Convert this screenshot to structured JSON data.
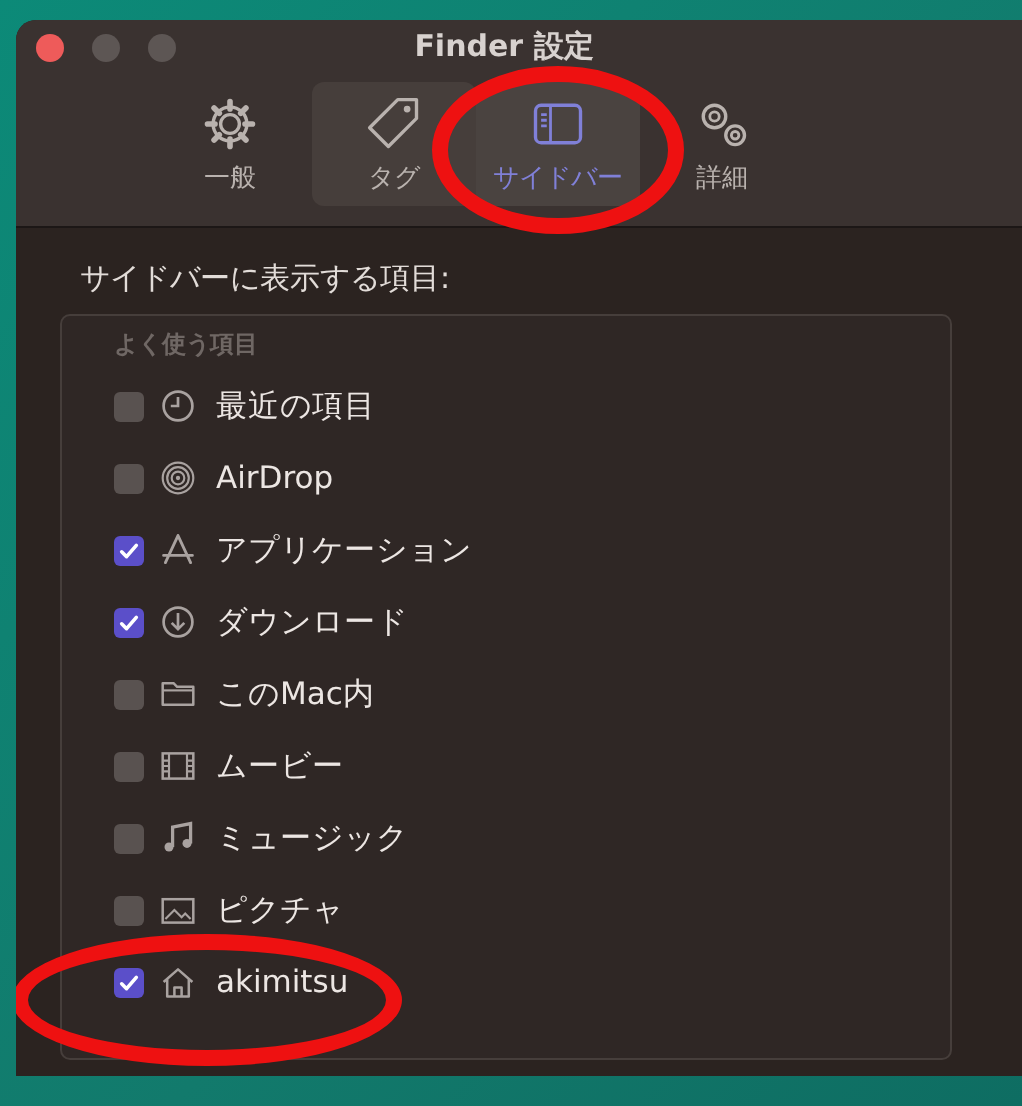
{
  "window": {
    "title": "Finder 設定"
  },
  "tabs": [
    {
      "label": "一般",
      "selected": false,
      "hovered": false,
      "circled": false
    },
    {
      "label": "タグ",
      "selected": false,
      "hovered": true,
      "circled": false
    },
    {
      "label": "サイドバー",
      "selected": true,
      "hovered": false,
      "circled": true
    },
    {
      "label": "詳細",
      "selected": false,
      "hovered": false,
      "circled": false
    }
  ],
  "section_label": "サイドバーに表示する項目:",
  "group_header": "よく使う項目",
  "items": [
    {
      "label": "最近の項目",
      "checked": false,
      "circled": false
    },
    {
      "label": "AirDrop",
      "checked": false,
      "circled": false
    },
    {
      "label": "アプリケーション",
      "checked": true,
      "circled": false
    },
    {
      "label": "ダウンロード",
      "checked": true,
      "circled": false
    },
    {
      "label": "このMac内",
      "checked": false,
      "circled": false
    },
    {
      "label": "ムービー",
      "checked": false,
      "circled": false
    },
    {
      "label": "ミュージック",
      "checked": false,
      "circled": false
    },
    {
      "label": "ピクチャ",
      "checked": false,
      "circled": false
    },
    {
      "label": "akimitsu",
      "checked": true,
      "circled": true
    }
  ]
}
